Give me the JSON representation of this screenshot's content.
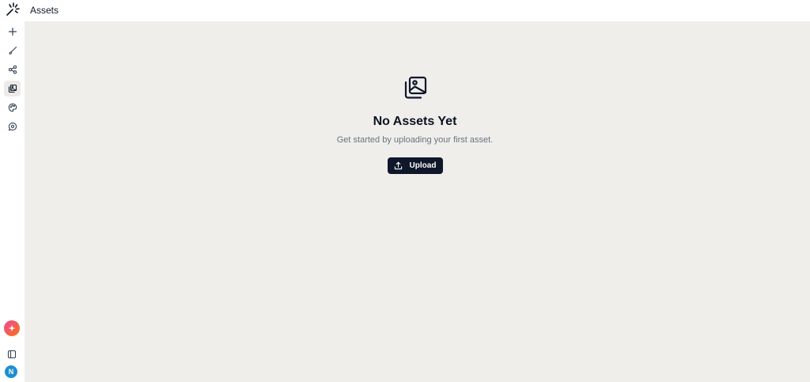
{
  "header": {
    "title": "Assets"
  },
  "sidebar": {
    "items": [
      {
        "icon": "plus-icon",
        "name": "new"
      },
      {
        "icon": "brush-icon",
        "name": "draw"
      },
      {
        "icon": "share-icon",
        "name": "share"
      },
      {
        "icon": "images-icon",
        "name": "assets",
        "active": true
      },
      {
        "icon": "palette-icon",
        "name": "palette"
      },
      {
        "icon": "chat-icon",
        "name": "chat"
      }
    ],
    "user_initial": "N"
  },
  "empty_state": {
    "icon": "images-icon",
    "title": "No Assets Yet",
    "subtitle": "Get started by uploading your first asset.",
    "upload_label": "Upload"
  },
  "colors": {
    "main_bg": "#efeeeb",
    "button_bg": "#0f172a",
    "avatar_bg": "#1d8ecf",
    "ai_gradient_start": "#ec4899",
    "ai_gradient_end": "#f97316"
  }
}
